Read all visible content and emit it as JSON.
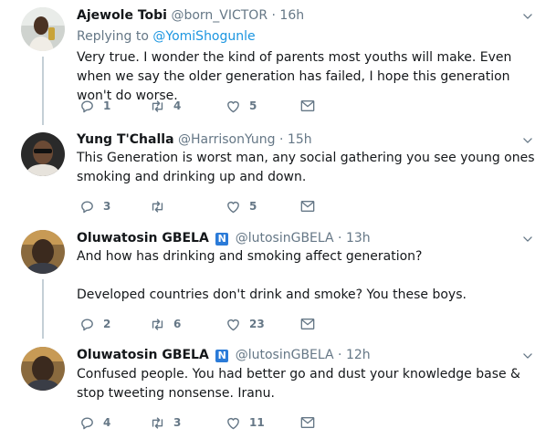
{
  "icons": {
    "reply": "reply-icon",
    "retweet": "retweet-icon",
    "like": "like-icon",
    "dm": "direct-message-icon",
    "caret": "chevron-down-icon",
    "verified": "n-badge-icon"
  },
  "colors": {
    "text": "#14171a",
    "muted": "#657786",
    "link": "#1b95e0",
    "thread_line": "#c4cfd6",
    "badge": "#2b7bd8"
  },
  "tweets": [
    {
      "name": "Ajewole Tobi",
      "handle": "@born_VICTOR",
      "time": "· 16h",
      "replying_prefix": "Replying to ",
      "replying_to": "@YomiShogunle",
      "text": "Very true. I wonder the kind of parents most youths will make. Even when we say the older generation has failed, I hope this generation won't do worse.",
      "replies": "1",
      "retweets": "4",
      "likes": "5"
    },
    {
      "name": "Yung T'Challa",
      "handle": "@HarrisonYung",
      "time": "· 15h",
      "text": "This Generation is worst man, any social gathering you see young ones smoking and drinking up and down.",
      "replies": "3",
      "retweets": "",
      "likes": "5"
    },
    {
      "name": "Oluwatosin GBELA",
      "badge": "N",
      "handle": "@lutosinGBELA",
      "time": "· 13h",
      "text1": "And how has drinking and smoking affect generation?",
      "text2": "Developed countries don't drink and smoke? You these boys.",
      "replies": "2",
      "retweets": "6",
      "likes": "23"
    },
    {
      "name": "Oluwatosin GBELA",
      "badge": "N",
      "handle": "@lutosinGBELA",
      "time": "· 12h",
      "text": "Confused people. You had better go and dust your knowledge base & stop tweeting nonsense. Iranu.",
      "replies": "4",
      "retweets": "3",
      "likes": "11"
    }
  ]
}
